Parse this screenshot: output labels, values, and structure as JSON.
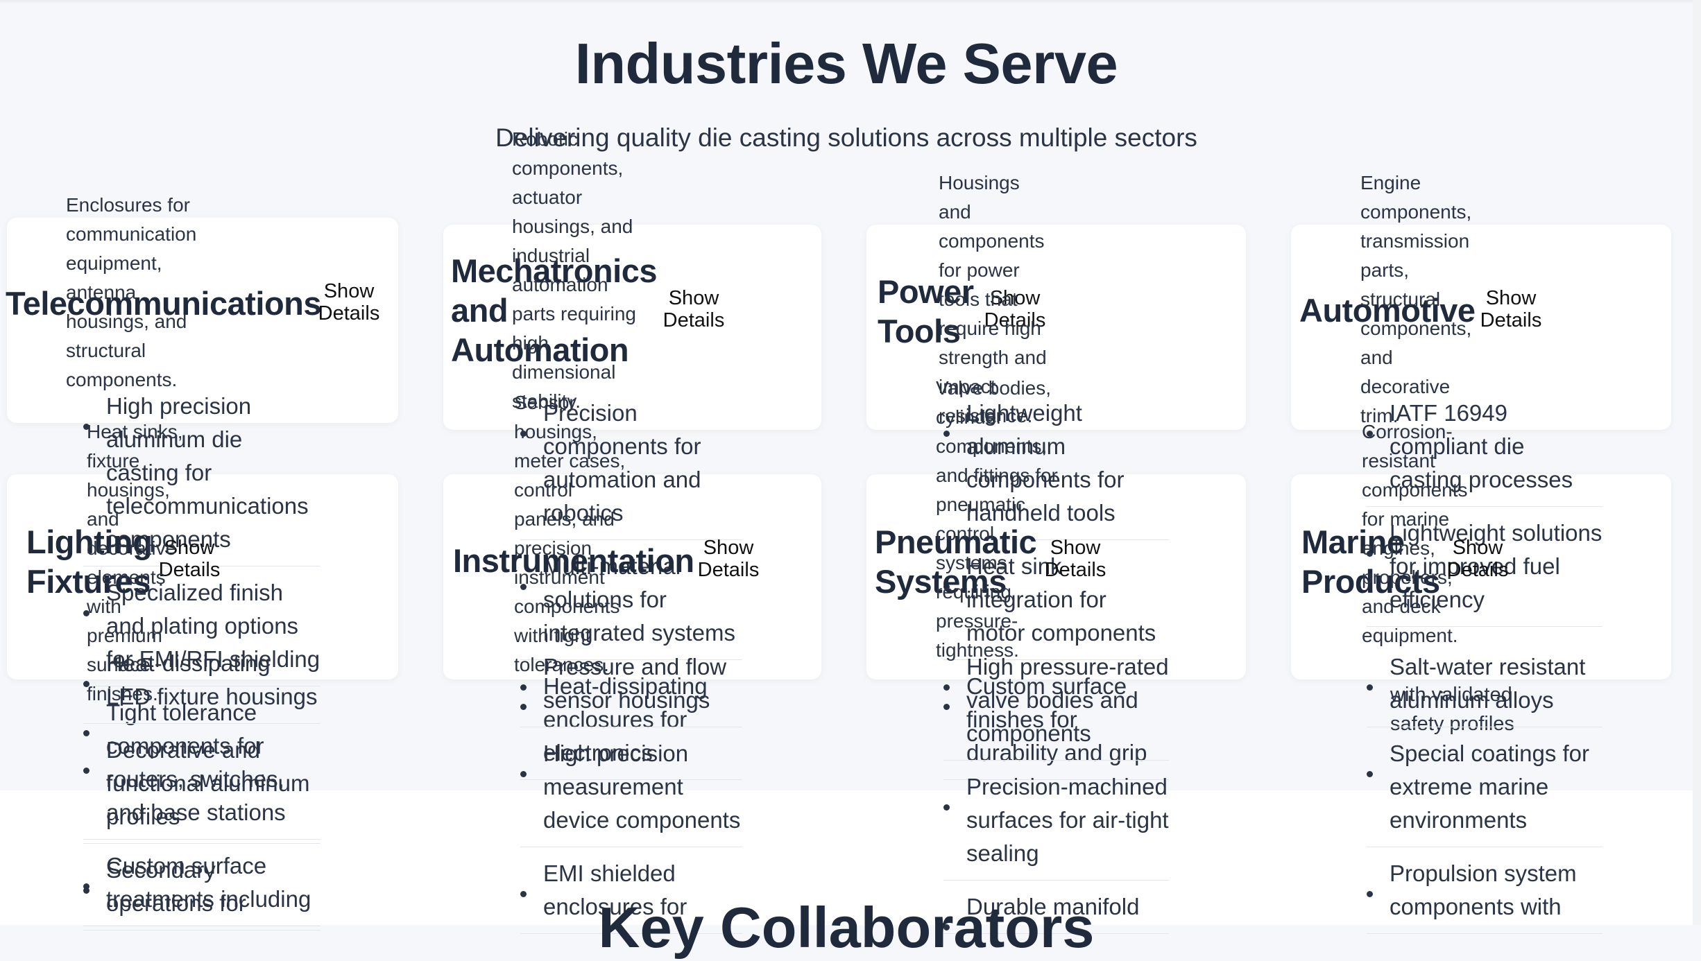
{
  "page": {
    "title": "Industries We Serve",
    "subtitle": "Delivering quality die casting solutions across multiple sectors"
  },
  "industries": [
    {
      "name": "Telecommunications",
      "button": "Show Details",
      "description": "Enclosures for communication equipment, antenna housings, and structural components.",
      "features": [
        "High precision aluminum die casting for telecommunications components",
        "Specialized finish and plating options for EMI/RFI shielding",
        "Tight tolerance components for routers, switches, and base stations",
        "Custom surface treatments including"
      ]
    },
    {
      "name": "Mechatronics and Automation",
      "button": "Show Details",
      "description": "Robotic components, actuator housings, and industrial automation parts requiring high dimensional stability.",
      "features": [
        "Precision components for automation and robotics",
        "Multi-material solutions for integrated systems",
        "Heat-dissipating enclosures for electronics"
      ]
    },
    {
      "name": "Power Tools",
      "button": "Show Details",
      "description": "Housings and components for power tools that require high strength and impact resistance.",
      "features": [
        "Lightweight aluminum components for handheld tools",
        "Heat sink integration for motor components",
        "Custom surface finishes for durability and grip"
      ]
    },
    {
      "name": "Automotive",
      "button": "Show Details",
      "description": "Engine components, transmission parts, structural components, and decorative trim.",
      "features": [
        "IATF 16949 compliant die casting processes",
        "Lightweight solutions for improved fuel efficiency"
      ]
    },
    {
      "name": "Lighting Fixtures",
      "button": "Show Details",
      "description": "Heat sinks, fixture housings, and decorative elements with premium surface finishes.",
      "features": [
        "Heat-dissipating LED fixture housings",
        "Decorative and functional aluminum profiles",
        "Secondary operations for"
      ]
    },
    {
      "name": "Instrumentation",
      "button": "Show Details",
      "description": "Sensor housings, meter cases, control panels, and precision instrument components with tight tolerances.",
      "features": [
        "Pressure and flow sensor housings",
        "High precision measurement device components",
        "EMI shielded enclosures for"
      ]
    },
    {
      "name": "Pneumatic Systems",
      "button": "Show Details",
      "description": "Valve bodies, cylinder components, and fittings for pneumatic control systems requiring pressure-tightness.",
      "features": [
        "High pressure-rated valve bodies and components",
        "Precision-machined surfaces for air-tight sealing",
        "Durable manifold"
      ]
    },
    {
      "name": "Marine Products",
      "button": "Show Details",
      "description": "Corrosion-resistant components for marine engines, propellers, and deck equipment.",
      "features": [
        "Salt-water resistant aluminum alloys",
        "Special coatings for extreme marine environments",
        "Propulsion system components with"
      ]
    }
  ],
  "overlay_fragments": {
    "automotive_validated": "with validated safety profiles"
  },
  "next_section": {
    "title": "Key Collaborators"
  }
}
